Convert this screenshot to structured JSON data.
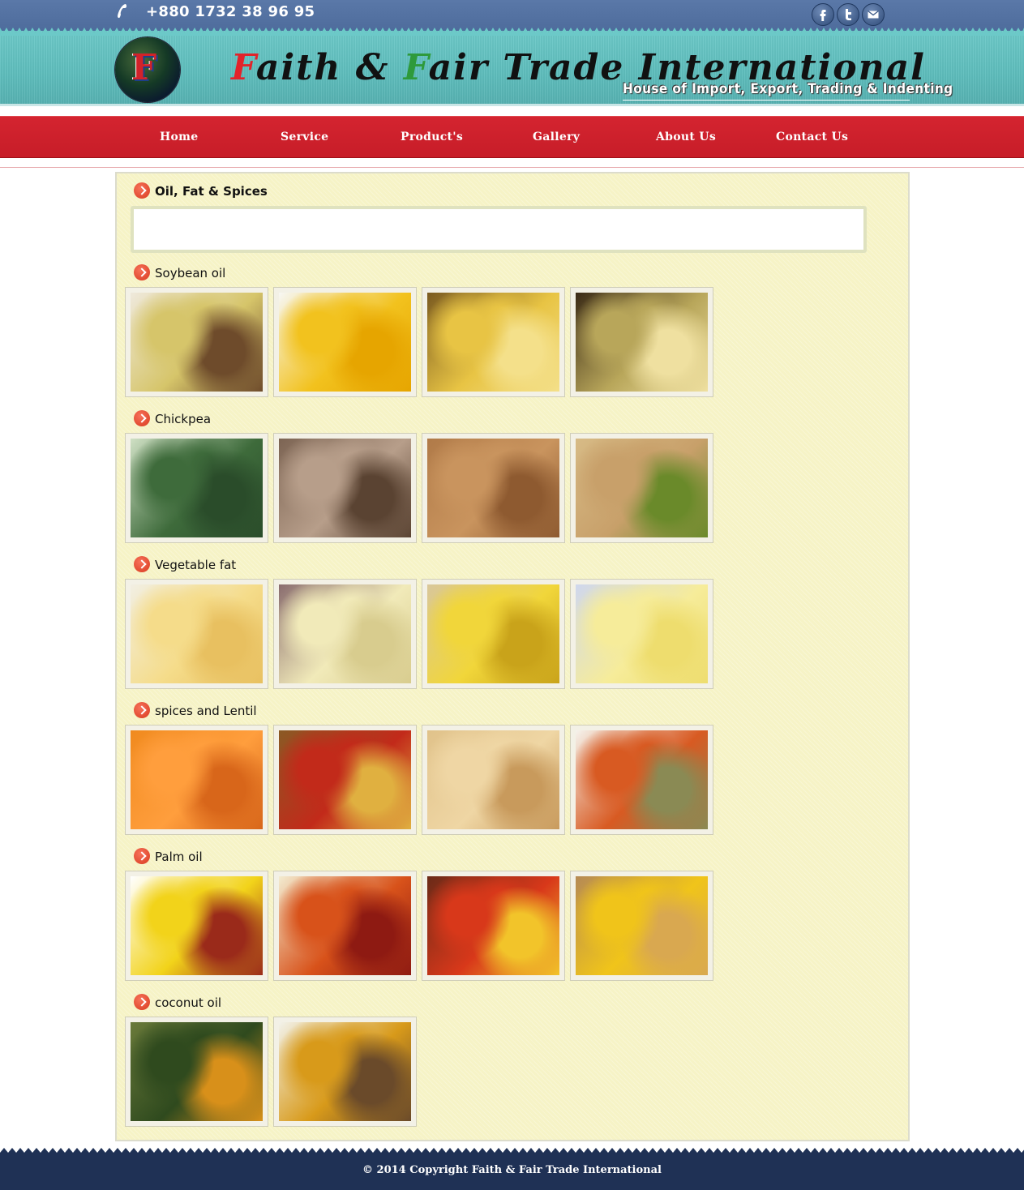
{
  "topbar": {
    "phone_icon": "phone-icon",
    "phone": "+880 1732 38 96 95",
    "social_icons": [
      "facebook-icon",
      "twitter-icon",
      "mail-icon"
    ]
  },
  "header": {
    "logo_icon": "globe-logo-icon",
    "brand_title": "Faith & Fair Trade International",
    "tagline": "House of Import, Export, Trading & Indenting"
  },
  "nav": {
    "items": [
      "Home",
      "Service",
      "Product's",
      "Gallery",
      "About Us",
      "Contact Us"
    ]
  },
  "content": {
    "page_heading": "Oil, Fat & Spices",
    "sections": [
      {
        "title": "Soybean oil",
        "images": [
          "soybean-oil-bottles-photo",
          "soybean-oil-bottle-photo",
          "soybean-oil-row-photo",
          "soybean-beaker-photo"
        ]
      },
      {
        "title": "Chickpea",
        "images": [
          "chickpea-plant-photo",
          "chickpea-dried-photo",
          "chickpea-pile-photo",
          "chickpea-hands-photo"
        ]
      },
      {
        "title": "Vegetable fat",
        "images": [
          "vegetable-fat-knife-photo",
          "vegetable-fat-spread-photo",
          "vegetable-fat-block-photo",
          "vegetable-fat-curls-photo"
        ]
      },
      {
        "title": "spices and Lentil",
        "images": [
          "red-lentil-photo",
          "spice-bowls-photo",
          "split-pea-photo",
          "mixed-lentils-photo"
        ]
      },
      {
        "title": "Palm oil",
        "images": [
          "palm-oil-bottle-photo",
          "palm-fruit-photo",
          "palm-fruit-bunch-photo",
          "palm-oil-crate-photo"
        ]
      },
      {
        "title": "coconut oil",
        "images": [
          "coconut-tree-photo",
          "coconut-oil-jar-photo"
        ]
      }
    ]
  },
  "footer": {
    "copyright": "© 2014 Copyright Faith & Fair Trade International"
  },
  "colors": {
    "topbar": "#5a78a8",
    "header_teal": "#5ebdbc",
    "nav_red": "#d42430",
    "content_bg": "#f6f3c6",
    "bullet": "#e8503a",
    "footer": "#1f3155"
  }
}
